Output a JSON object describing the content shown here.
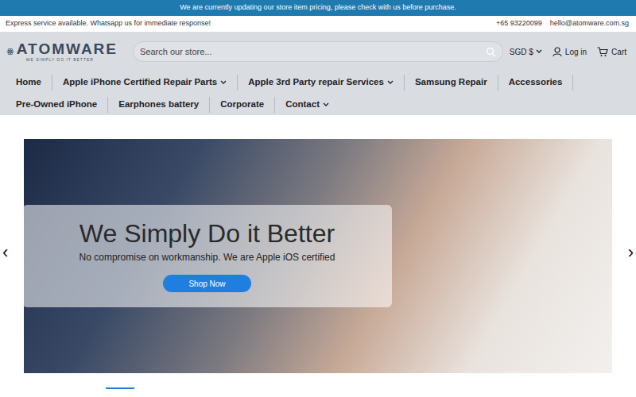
{
  "announcement": "We are currently updating our store item pricing, please check with us before purchase.",
  "utility_bar": {
    "left": "Express service available. Whatsapp us for immediate response!",
    "phone": "+65 93220099",
    "email": "hello@atomware.com.sg"
  },
  "logo": {
    "name": "ATOMWARE",
    "tagline": "WE SIMPLY DO IT BETTER"
  },
  "search": {
    "placeholder": "Search our store..."
  },
  "currency": "SGD $",
  "login": "Log in",
  "cart": "Cart",
  "nav": [
    {
      "label": "Home",
      "dropdown": false
    },
    {
      "label": "Apple iPhone Certified Repair Parts",
      "dropdown": true
    },
    {
      "label": "Apple 3rd Party repair Services",
      "dropdown": true
    },
    {
      "label": "Samsung Repair",
      "dropdown": false
    },
    {
      "label": "Accessories",
      "dropdown": false
    },
    {
      "label": "Pre-Owned iPhone",
      "dropdown": false
    },
    {
      "label": "Earphones battery",
      "dropdown": false
    },
    {
      "label": "Corporate",
      "dropdown": false
    },
    {
      "label": "Contact",
      "dropdown": true
    }
  ],
  "hero": {
    "heading": "We Simply Do it Better",
    "subtitle": "No compromise on workmanship. We are Apple iOS certified",
    "button": "Shop Now",
    "prev": "‹",
    "next": "›"
  }
}
